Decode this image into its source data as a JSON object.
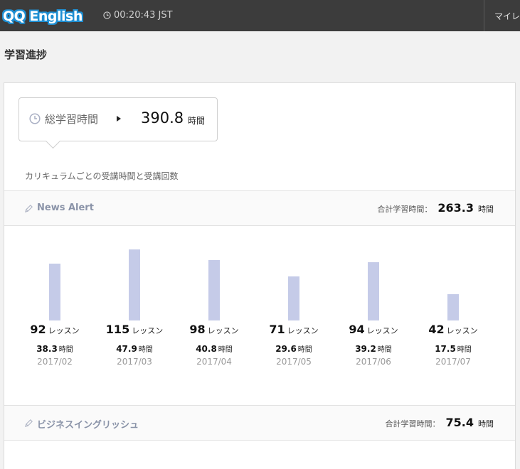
{
  "header": {
    "logo_text": "QQ English",
    "time": "00:20:43 JST",
    "mypage_label": "マイレ"
  },
  "page": {
    "title": "学習進捗"
  },
  "summary": {
    "label": "総学習時間",
    "value": "390.8",
    "unit": "時間",
    "subtitle": "カリキュラムごとの受講時間と受講回数"
  },
  "sections": [
    {
      "name": "News Alert",
      "total_label": "合計学習時間：",
      "total_value": "263.3",
      "total_unit": "時間"
    },
    {
      "name": "ビジネスイングリッシュ",
      "total_label": "合計学習時間：",
      "total_value": "75.4",
      "total_unit": "時間"
    }
  ],
  "colors": {
    "topbar": "#3c3c3c",
    "bar": "#c5cbe8",
    "section_name": "#8a93a8"
  },
  "chart_data": {
    "type": "bar",
    "categories": [
      "2017/02",
      "2017/03",
      "2017/04",
      "2017/05",
      "2017/06",
      "2017/07"
    ],
    "series": [
      {
        "values": [
          38.3,
          47.9,
          40.8,
          29.6,
          39.2,
          17.5
        ]
      }
    ],
    "lessons": [
      92,
      115,
      98,
      71,
      94,
      42
    ],
    "lesson_unit": "レッスン",
    "hour_unit": "時間",
    "ylim": [
      0,
      47.9
    ]
  }
}
